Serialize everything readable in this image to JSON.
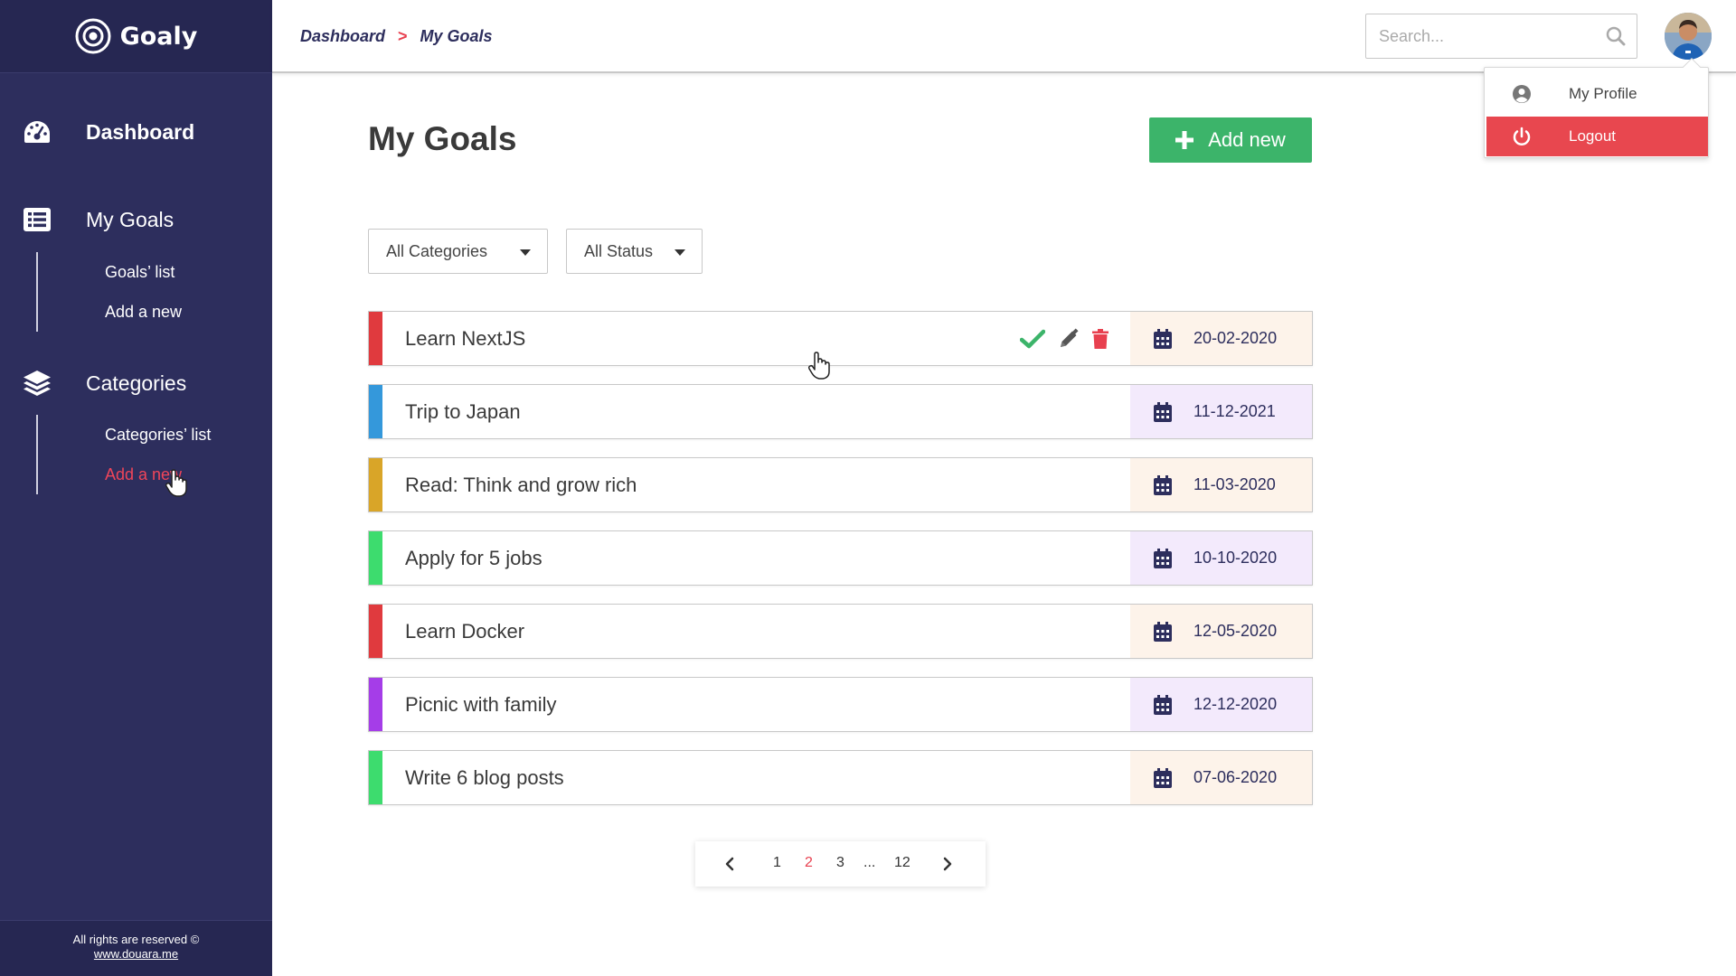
{
  "brand": {
    "name": "Goaly"
  },
  "sidebar": {
    "sections": [
      {
        "label": "Dashboard",
        "icon": "dashboard-gauge-icon"
      },
      {
        "label": "My Goals",
        "icon": "list-icon",
        "items": [
          "Goals’ list",
          "Add a new"
        ]
      },
      {
        "label": "Categories",
        "icon": "layers-icon",
        "items": [
          "Categories’ list",
          "Add a new"
        ]
      }
    ],
    "footer": {
      "text": "All rights are reserved ©",
      "link": "www.douara.me"
    }
  },
  "header": {
    "breadcrumb": [
      "Dashboard",
      ">",
      "My Goals"
    ],
    "search_placeholder": "Search...",
    "profile_menu": {
      "profile": "My Profile",
      "logout": "Logout"
    }
  },
  "main": {
    "title": "My Goals",
    "add_button": "Add new",
    "filters": {
      "category": "All Categories",
      "status": "All Status"
    },
    "goals": [
      {
        "title": "Learn NextJS",
        "date": "20-02-2020",
        "color": "#e03a3e",
        "date_bg": "#fdf3ea"
      },
      {
        "title": "Trip to Japan",
        "date": "11-12-2021",
        "color": "#3498db",
        "date_bg": "#f3eafc"
      },
      {
        "title": "Read: Think and grow rich",
        "date": "11-03-2020",
        "color": "#d9a528",
        "date_bg": "#fdf3ea"
      },
      {
        "title": "Apply for 5 jobs",
        "date": "10-10-2020",
        "color": "#3ddc6e",
        "date_bg": "#f3eafc"
      },
      {
        "title": "Learn Docker",
        "date": "12-05-2020",
        "color": "#e03a3e",
        "date_bg": "#fdf3ea"
      },
      {
        "title": "Picnic with family",
        "date": "12-12-2020",
        "color": "#a53de8",
        "date_bg": "#f3eafc"
      },
      {
        "title": "Write 6 blog posts",
        "date": "07-06-2020",
        "color": "#3ddc6e",
        "date_bg": "#fdf3ea"
      }
    ],
    "pagination": {
      "pages": [
        "1",
        "2",
        "3",
        "...",
        "12"
      ],
      "current": "2"
    }
  },
  "colors": {
    "sidebar": "#2d2e5d",
    "accent_red": "#e8404f",
    "add_green": "#3cb46a"
  }
}
